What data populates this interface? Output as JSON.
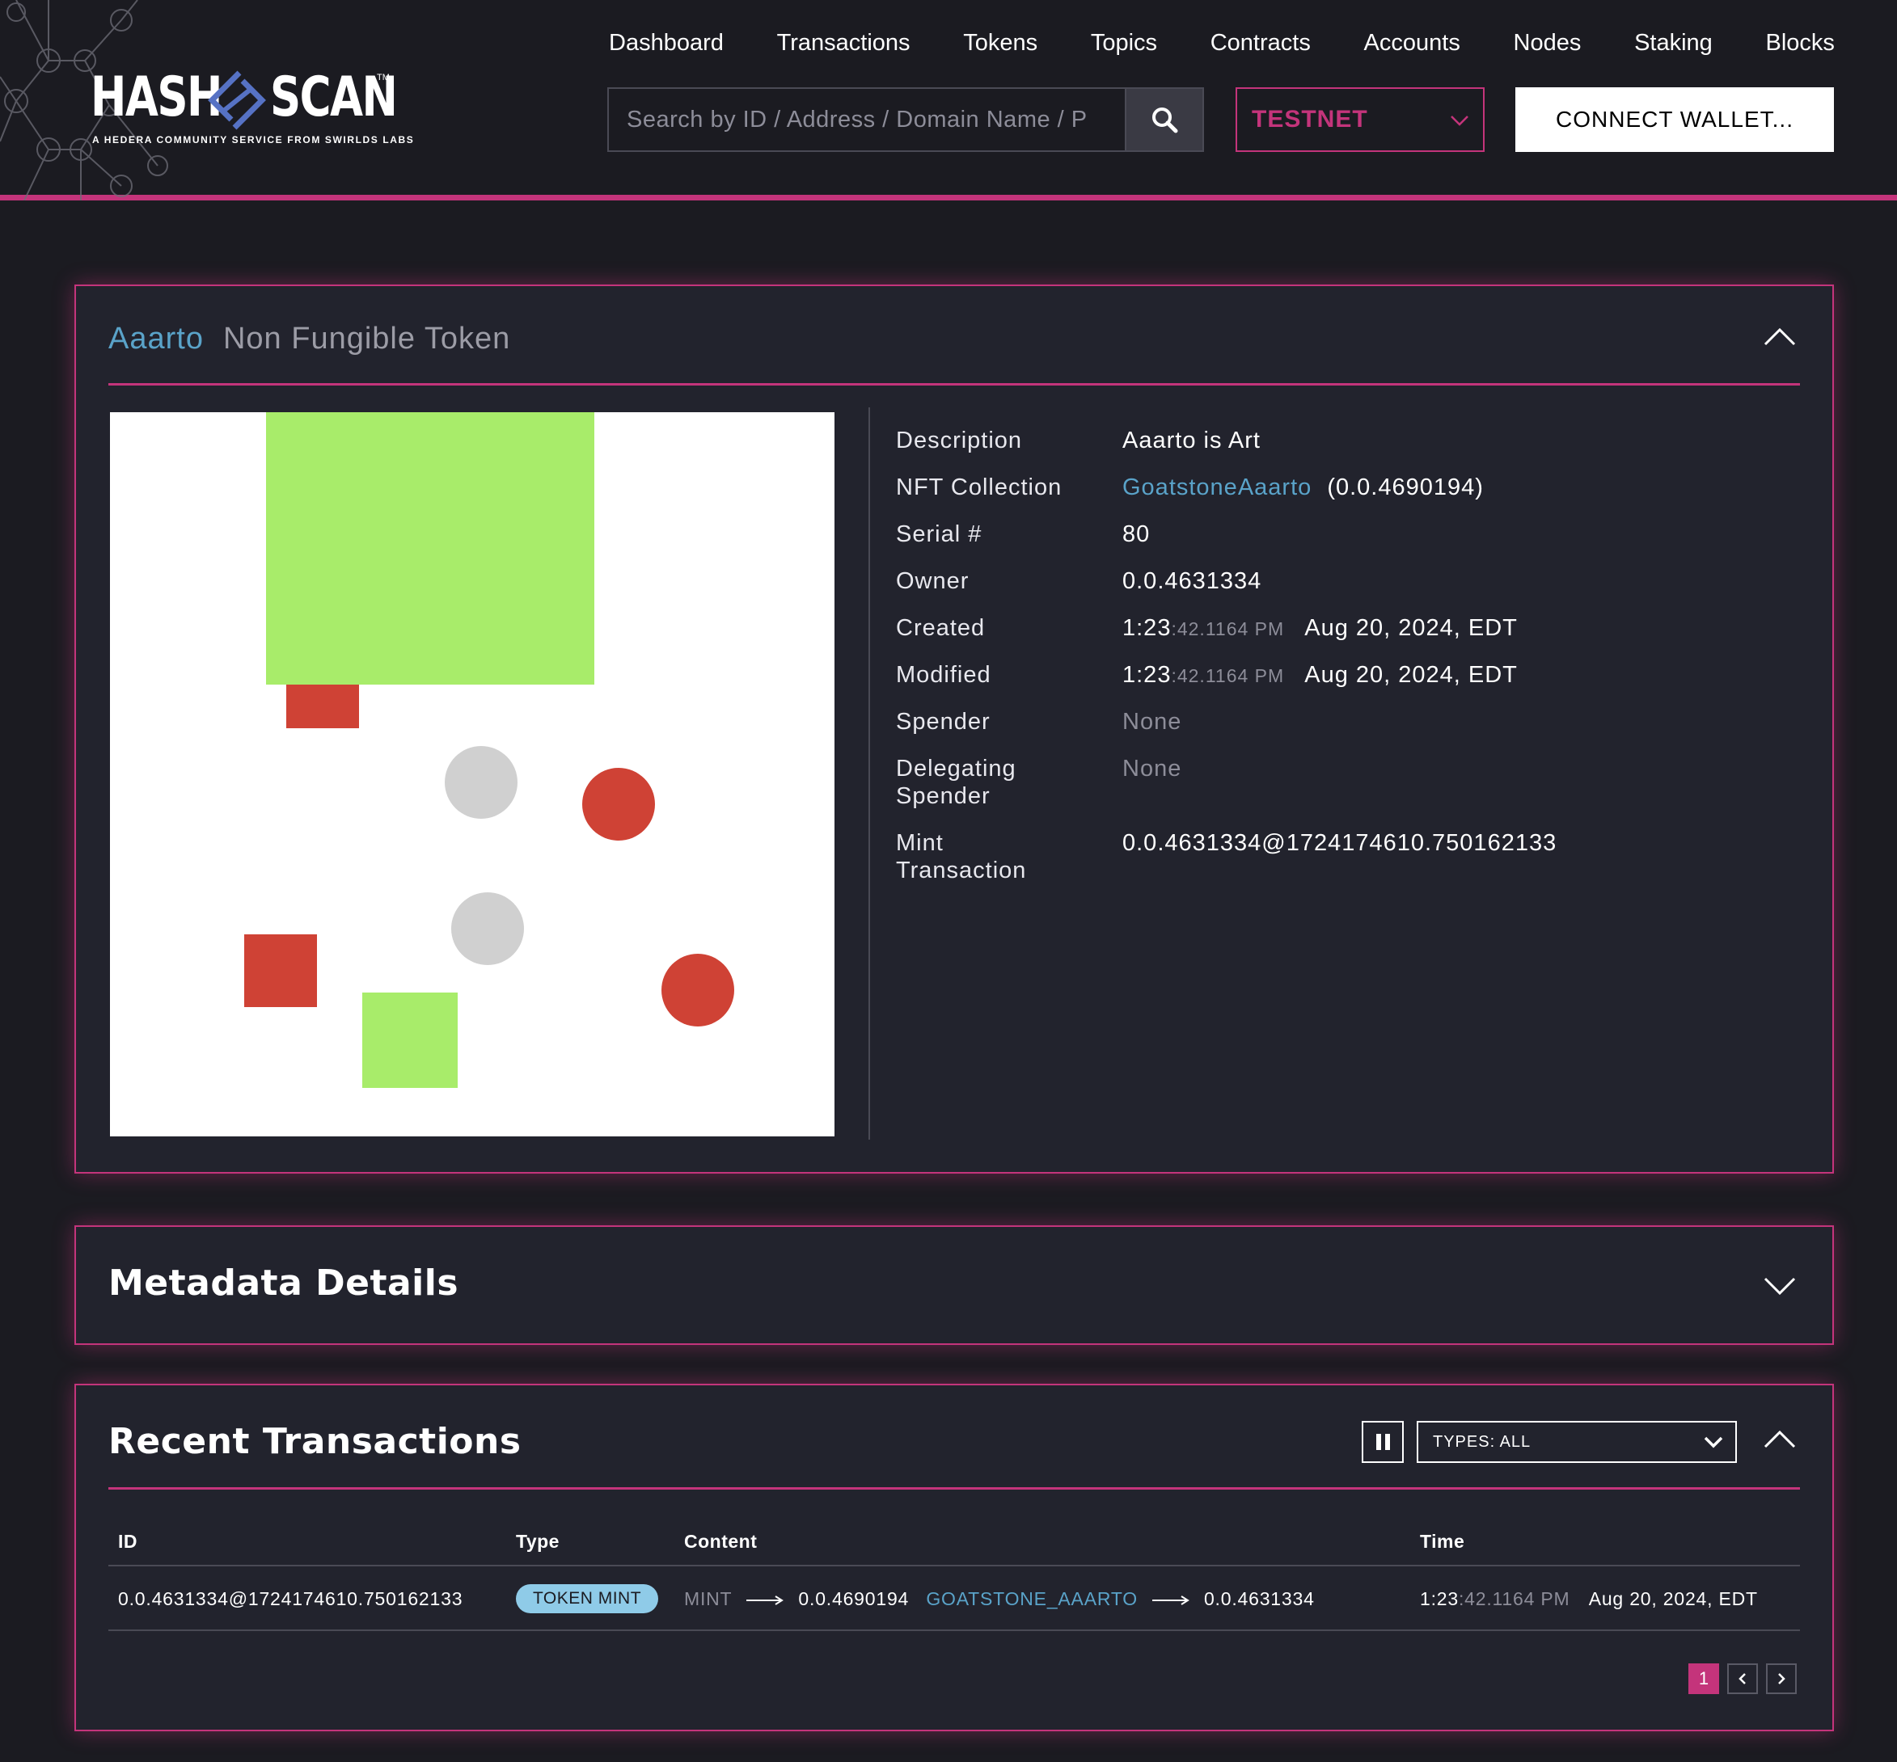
{
  "header": {
    "logo": {
      "left_text": "HASH",
      "right_text": "SCAN",
      "tm": "TM",
      "tagline": "A HEDERA COMMUNITY SERVICE FROM SWIRLDS LABS"
    },
    "nav": [
      "Dashboard",
      "Transactions",
      "Tokens",
      "Topics",
      "Contracts",
      "Accounts",
      "Nodes",
      "Staking",
      "Blocks"
    ],
    "search": {
      "placeholder": "Search by ID / Address / Domain Name / P",
      "icon": "search-icon"
    },
    "network": {
      "value": "TESTNET",
      "icon": "chevron-down-icon"
    },
    "connect_label": "CONNECT WALLET..."
  },
  "token_panel": {
    "name": "Aaarto",
    "type": "Non Fungible Token",
    "properties": {
      "description_label": "Description",
      "description_value": "Aaarto is Art",
      "collection_label": "NFT Collection",
      "collection_name": "GoatstoneAaarto",
      "collection_id": "(0.0.4690194)",
      "serial_label": "Serial #",
      "serial_value": "80",
      "owner_label": "Owner",
      "owner_value": "0.0.4631334",
      "created_label": "Created",
      "created_hm": "1:23",
      "created_sec": ":42.1164 PM",
      "created_date": "Aug 20, 2024, EDT",
      "modified_label": "Modified",
      "modified_hm": "1:23",
      "modified_sec": ":42.1164 PM",
      "modified_date": "Aug 20, 2024, EDT",
      "spender_label": "Spender",
      "spender_value": "None",
      "delegating_label_1": "Delegating",
      "delegating_label_2": "Spender",
      "delegating_value": "None",
      "mint_label_1": "Mint",
      "mint_label_2": "Transaction",
      "mint_value": "0.0.4631334@1724174610.750162133"
    },
    "colors": {
      "green": "#a8ec6a",
      "red": "#cf4235",
      "gray": "#d0d0d0"
    }
  },
  "metadata_panel": {
    "title": "Metadata Details"
  },
  "transactions_panel": {
    "title": "Recent Transactions",
    "filter": "TYPES: ALL",
    "columns": [
      "ID",
      "Type",
      "Content",
      "Time"
    ],
    "rows": [
      {
        "id": "0.0.4631334@1724174610.750162133",
        "type": "TOKEN MINT",
        "content_action": "MINT",
        "content_from": "0.0.4690194",
        "content_token": "GOATSTONE_AAARTO",
        "content_to": "0.0.4631334",
        "time_hm": "1:23",
        "time_sec": ":42.1164 PM",
        "time_date": "Aug 20, 2024, EDT"
      }
    ],
    "pagination": {
      "current": "1"
    }
  }
}
